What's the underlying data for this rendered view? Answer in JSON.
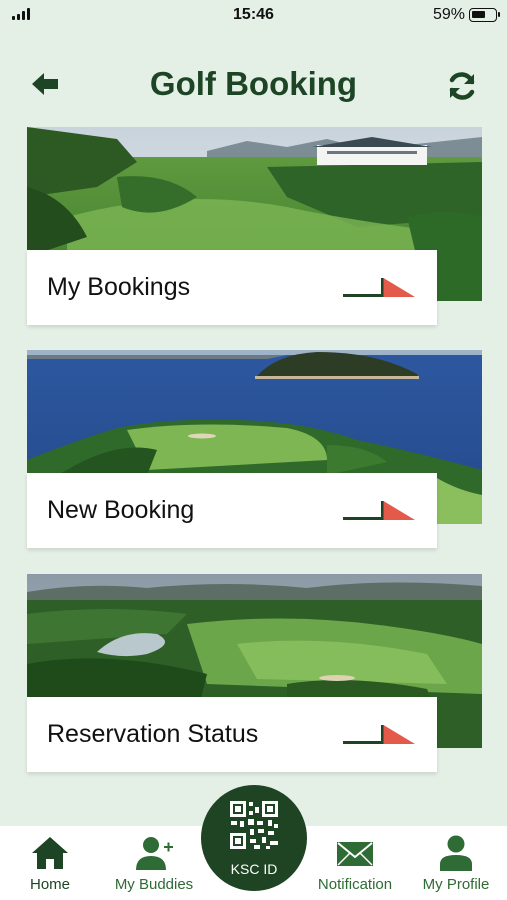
{
  "status_bar": {
    "time": "15:46",
    "battery": "59%"
  },
  "header": {
    "title": "Golf Booking"
  },
  "cards": [
    {
      "label": "My Bookings"
    },
    {
      "label": "New Booking"
    },
    {
      "label": "Reservation Status"
    }
  ],
  "nav": {
    "home": "Home",
    "buddies": "My Buddies",
    "ksc_id": "KSC ID",
    "notification": "Notification",
    "profile": "My Profile"
  },
  "colors": {
    "brand_green": "#1d4525",
    "background": "#e4efe6",
    "flag_red": "#e35a4b"
  },
  "icons": {
    "back": "arrow-left-icon",
    "refresh": "refresh-icon",
    "flag": "golf-flag-icon",
    "home": "home-icon",
    "buddies": "add-user-icon",
    "qr": "qr-code-icon",
    "notification": "envelope-icon",
    "profile": "user-icon"
  }
}
